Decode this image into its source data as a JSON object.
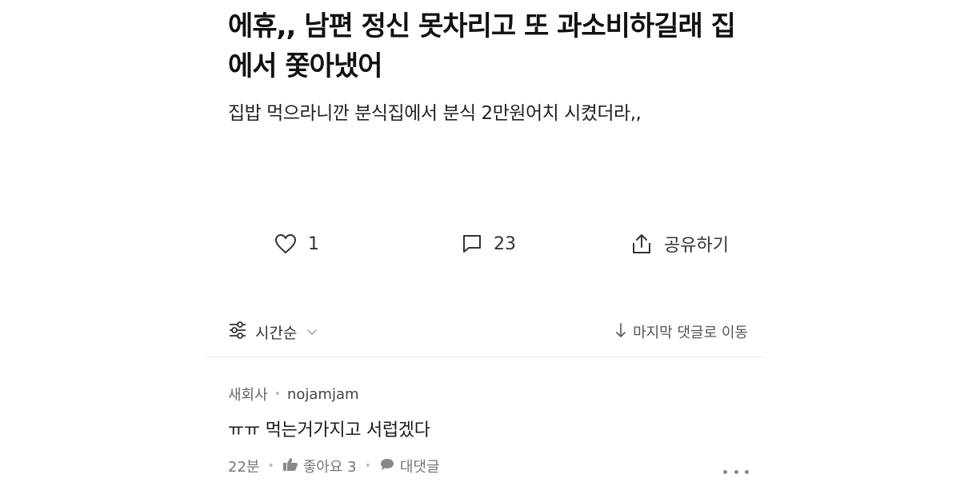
{
  "post": {
    "title": "에휴,, 남편 정신 못차리고 또 과소비하길래 집에서 쫓아냈어",
    "body": "집밥 먹으라니깐 분식집에서 분식 2만원어치 시켰더라,,"
  },
  "actions": {
    "like_count": "1",
    "comment_count": "23",
    "share_label": "공유하기"
  },
  "sort": {
    "label": "시간순",
    "jump_label": "마지막 댓글로 이동"
  },
  "comments": [
    {
      "badge": "새회사",
      "author": "nojamjam",
      "text": "ㅠㅠ 먹는거가지고 서럽겠다",
      "time": "22분",
      "like_label": "좋아요 3",
      "reply_label": "대댓글"
    }
  ],
  "icons": {
    "like": "heart-icon",
    "comment": "comment-bubble-icon",
    "share": "share-icon",
    "sort": "filter-sliders-icon",
    "chevron": "chevron-down-icon",
    "jump": "arrow-down-icon",
    "thumb": "thumbs-up-icon",
    "reply": "reply-bubble-icon",
    "more": "more-dots-icon"
  }
}
